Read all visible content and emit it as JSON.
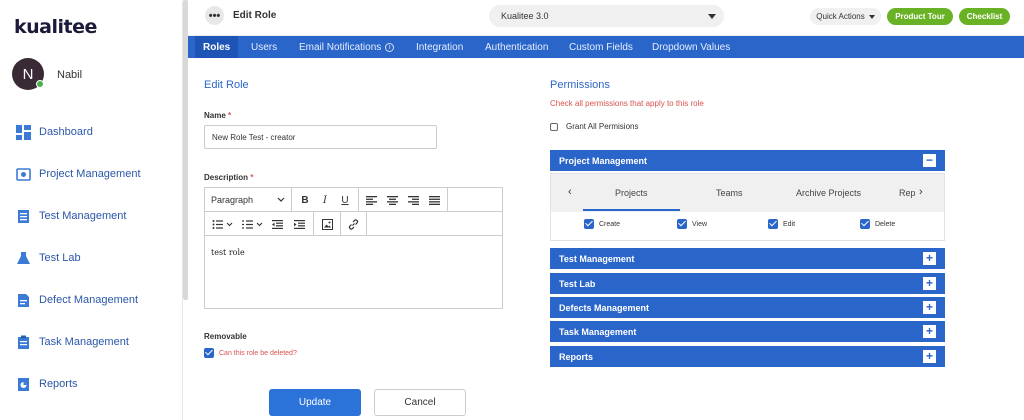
{
  "app": {
    "logo": "kualitee"
  },
  "user": {
    "initial": "N",
    "name": "Nabil"
  },
  "sidebar": {
    "items": [
      {
        "label": "Dashboard",
        "icon": "dashboard-icon"
      },
      {
        "label": "Project Management",
        "icon": "project-icon"
      },
      {
        "label": "Test Management",
        "icon": "test-icon"
      },
      {
        "label": "Test Lab",
        "icon": "flask-icon"
      },
      {
        "label": "Defect Management",
        "icon": "defect-icon"
      },
      {
        "label": "Task Management",
        "icon": "task-icon"
      },
      {
        "label": "Reports",
        "icon": "reports-icon"
      }
    ]
  },
  "header": {
    "menu_glyph": "•••",
    "title": "Edit Role",
    "project": "Kualitee 3.0",
    "quick_actions": "Quick Actions",
    "product_tour": "Product Tour",
    "checklist": "Checklist"
  },
  "tabs": [
    {
      "label": "Roles",
      "active": true
    },
    {
      "label": "Users"
    },
    {
      "label": "Email Notifications"
    },
    {
      "label": "Integration"
    },
    {
      "label": "Authentication"
    },
    {
      "label": "Custom Fields"
    },
    {
      "label": "Dropdown Values"
    }
  ],
  "form": {
    "section_title": "Edit Role",
    "name_label": "Name",
    "name_value": "New Role Test - creator",
    "description_label": "Description",
    "paragraph_select": "Paragraph",
    "description_value": "test role",
    "removable_label": "Removable",
    "removable_checkbox_label": "Can this role be deleted?",
    "removable_checked": true,
    "required_mark": "*",
    "update_button": "Update",
    "cancel_button": "Cancel"
  },
  "permissions": {
    "title": "Permissions",
    "subtitle": "Check all permissions that apply to this role",
    "grant_all": "Grant All Permisions",
    "expanded": {
      "title": "Project Management",
      "toggle": "−",
      "subtabs": [
        "Projects",
        "Teams",
        "Archive Projects",
        "Rep"
      ],
      "checks": [
        {
          "label": "Create",
          "checked": true
        },
        {
          "label": "View",
          "checked": true
        },
        {
          "label": "Edit",
          "checked": true
        },
        {
          "label": "Delete",
          "checked": true
        }
      ]
    },
    "collapsed": [
      {
        "title": "Test Management",
        "toggle": "+"
      },
      {
        "title": "Test Lab",
        "toggle": "+"
      },
      {
        "title": "Defects Management",
        "toggle": "+"
      },
      {
        "title": "Task Management",
        "toggle": "+"
      },
      {
        "title": "Reports",
        "toggle": "+"
      }
    ]
  },
  "colors": {
    "primary": "#2a65c9",
    "green": "#6ab225",
    "required": "#d9534f"
  }
}
